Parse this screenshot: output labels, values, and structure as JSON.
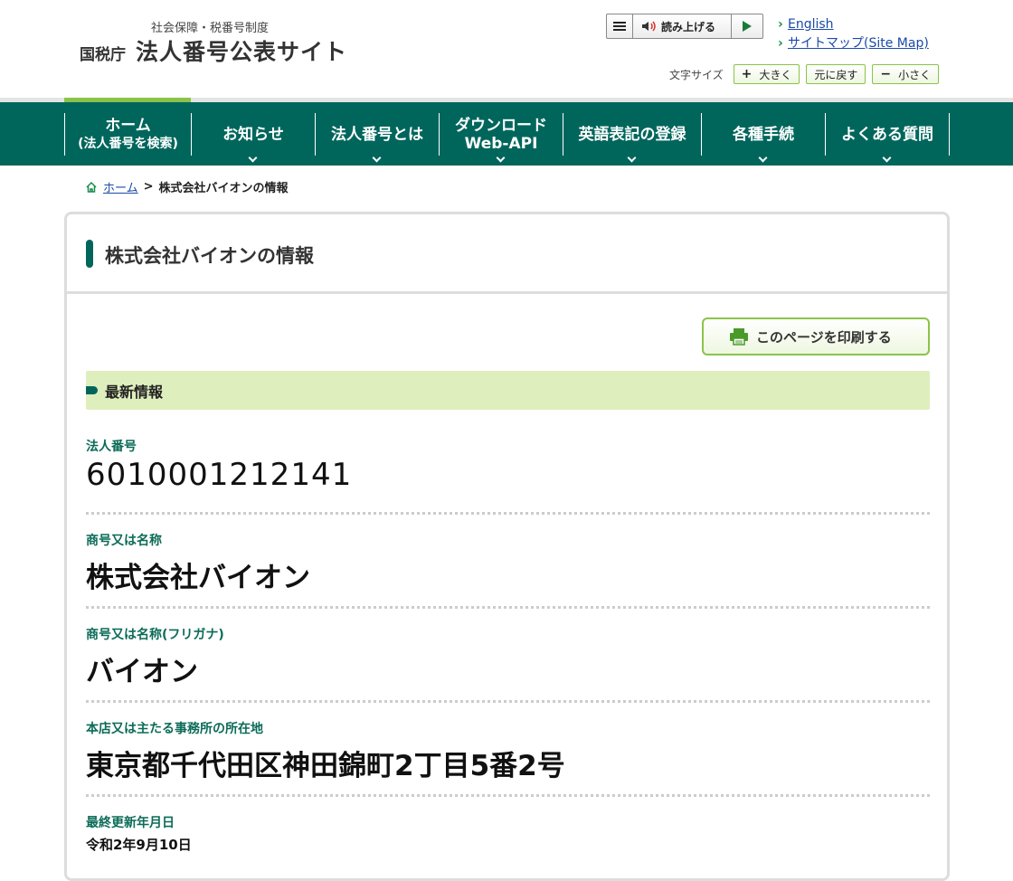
{
  "header": {
    "sub_title": "社会保障・税番号制度",
    "agency": "国税庁",
    "site_name": "法人番号公表サイト",
    "read_aloud": "読み上げる",
    "links": [
      "English",
      "サイトマップ(Site Map)"
    ],
    "font_size_label": "文字サイズ",
    "font_buttons": {
      "larger": "大きく",
      "reset": "元に戻す",
      "smaller": "小さく"
    }
  },
  "nav": {
    "items": [
      {
        "line1": "ホーム",
        "line2": "(法人番号を検索)"
      },
      {
        "line1": "お知らせ"
      },
      {
        "line1": "法人番号とは"
      },
      {
        "line1": "ダウンロード",
        "line2": "Web-API"
      },
      {
        "line1": "英語表記の登録"
      },
      {
        "line1": "各種手続"
      },
      {
        "line1": "よくある質問"
      }
    ]
  },
  "breadcrumb": {
    "home": "ホーム",
    "separator": ">",
    "current": "株式会社バイオンの情報"
  },
  "main": {
    "title": "株式会社バイオンの情報",
    "print_button": "このページを印刷する",
    "section_title": "最新情報",
    "fields": [
      {
        "label": "法人番号",
        "value": "6010001212141"
      },
      {
        "label": "商号又は名称",
        "value": "株式会社バイオン"
      },
      {
        "label": "商号又は名称(フリガナ)",
        "value": "バイオン"
      },
      {
        "label": "本店又は主たる事務所の所在地",
        "value": "東京都千代田区神田錦町2丁目5番2号"
      },
      {
        "label": "最終更新年月日",
        "value": "令和2年9月10日"
      }
    ]
  },
  "colors": {
    "nav_bg": "#00665c",
    "accent_green": "#8bc34a",
    "section_bg": "#dfeebd",
    "label_green": "#0c6b58",
    "link_blue": "#1a4aa8"
  }
}
